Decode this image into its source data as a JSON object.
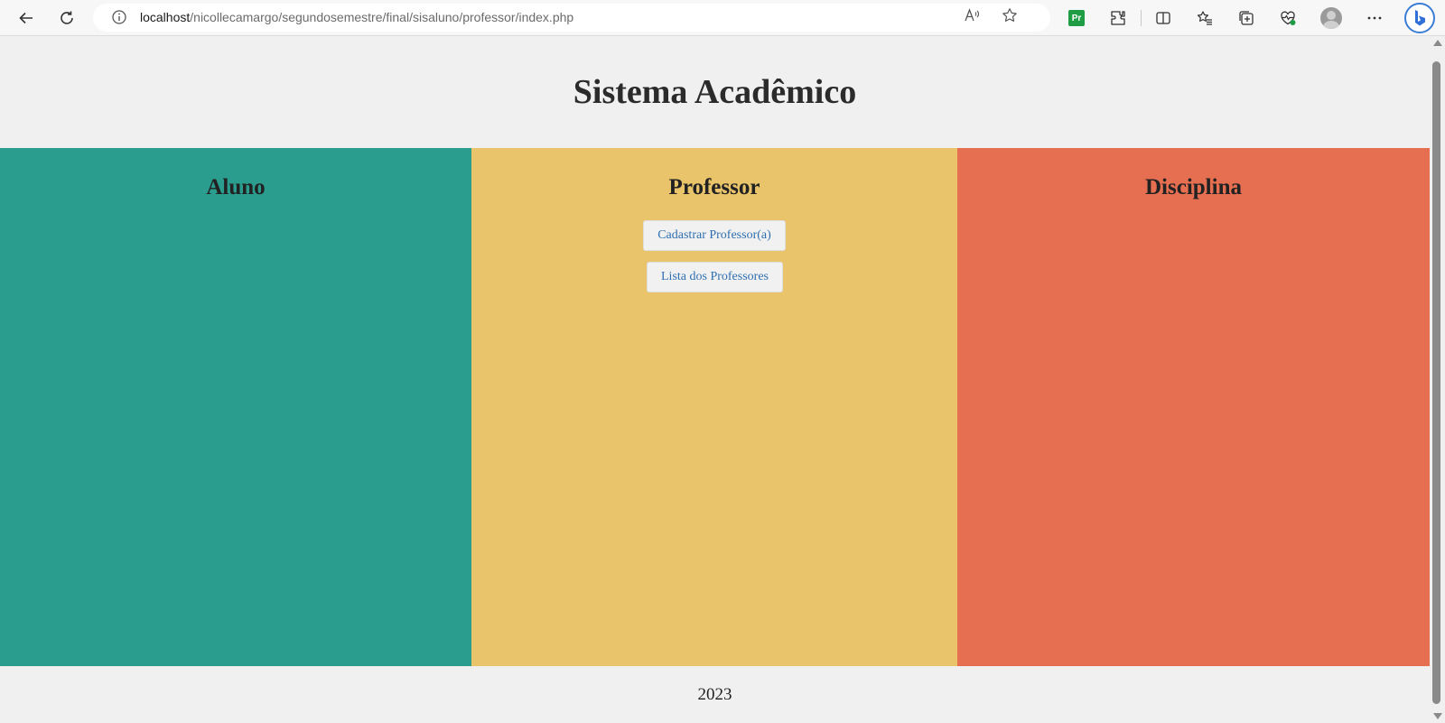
{
  "browser": {
    "url_host": "localhost",
    "url_path": "/nicollecamargo/segundosemestre/final/sisaluno/professor/index.php",
    "toolbar_icons": [
      "back-icon",
      "refresh-icon",
      "site-info-icon",
      "read-aloud-icon",
      "favorite-star-icon",
      "pr-extension-icon",
      "extensions-icon",
      "split-screen-icon",
      "favorites-icon",
      "collections-icon",
      "browser-essentials-icon",
      "profile-icon",
      "more-icon",
      "copilot-icon"
    ],
    "extension_label": "Pr"
  },
  "page": {
    "title": "Sistema Acadêmico",
    "columns": [
      {
        "title": "Aluno",
        "color": "#2a9d8f"
      },
      {
        "title": "Professor",
        "color": "#e9c46a",
        "buttons": [
          "Cadastrar Professor(a)",
          "Lista dos Professores"
        ]
      },
      {
        "title": "Disciplina",
        "color": "#e76f51"
      }
    ],
    "footer": "2023"
  }
}
